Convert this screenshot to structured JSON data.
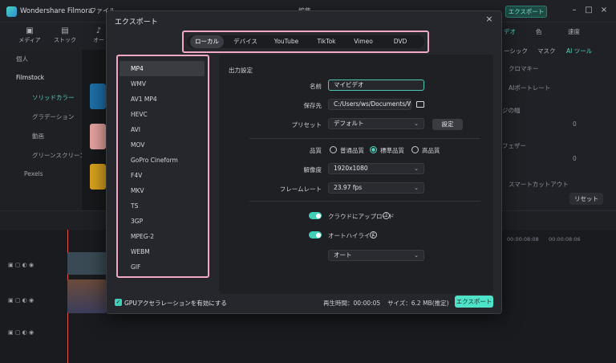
{
  "app": {
    "title": "Wondershare Filmora",
    "menu": [
      "ファイル",
      "編集"
    ],
    "export_button": "エクスポート"
  },
  "left_toolbar": [
    {
      "label": "メディア",
      "icon": "media-icon"
    },
    {
      "label": "ストック",
      "icon": "stock-icon"
    },
    {
      "label": "オー",
      "icon": "audio-icon"
    }
  ],
  "left_panel": {
    "items": [
      "個人",
      "Filmstock",
      "ソリッドカラー",
      "グラデーション",
      "動画",
      "グリーンスクリーン",
      "Pexels"
    ]
  },
  "right_panel": {
    "tabs": [
      "デオ",
      "色",
      "速度"
    ],
    "subtabs": [
      "ーシック",
      "マスク",
      "AI ツール"
    ],
    "items": [
      "クロマキー",
      "AIポートレート",
      "ジの幅",
      "フェザー",
      "スマートカットアウト"
    ],
    "values": [
      "0",
      "0"
    ],
    "reset": "リセット"
  },
  "timeline": {
    "times": [
      "00:00:08:08",
      "00:00:08:06"
    ]
  },
  "dialog": {
    "title": "エクスポート",
    "close": "×",
    "tabs": [
      "ローカル",
      "デバイス",
      "YouTube",
      "TikTok",
      "Vimeo",
      "DVD"
    ],
    "active_tab": "ローカル",
    "formats": [
      "MP4",
      "WMV",
      "AV1 MP4",
      "HEVC",
      "AVI",
      "MOV",
      "GoPro Cineform",
      "F4V",
      "MKV",
      "TS",
      "3GP",
      "MPEG-2",
      "WEBM",
      "GIF"
    ],
    "selected_format": "MP4",
    "section_title": "出力設定",
    "name_label": "名前",
    "name_value": "マイビデオ",
    "save_label": "保存先",
    "save_value": "C:/Users/ws/Documents/Won",
    "preset_label": "プリセット",
    "preset_value": "デフォルト",
    "settings_button": "設定",
    "quality_label": "品質",
    "quality_options": [
      "普通品質",
      "標準品質",
      "高品質"
    ],
    "quality_selected": "標準品質",
    "resolution_label": "解像度",
    "resolution_value": "1920x1080",
    "framerate_label": "フレームレート",
    "framerate_value": "23.97 fps",
    "cloud_upload_label": "クラウドにアップロード",
    "auto_highlight_label": "オートハイライト",
    "auto_value": "オート",
    "gpu_label": "GPUアクセラレーションを有効にする",
    "duration": "再生時間：00:00:05",
    "size": "サイズ：6.2 MB(推定)",
    "export_button": "エクスポート"
  },
  "colors": {
    "accent": "#4ee2c9",
    "highlight_outline": "#f0a8c4",
    "dialog_bg": "#26272c"
  }
}
